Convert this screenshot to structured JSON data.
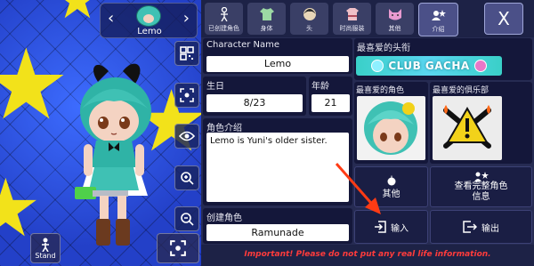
{
  "selector": {
    "name": "Lemo",
    "prev_glyph": "‹",
    "next_glyph": "›"
  },
  "stage": {
    "stand_label": "Stand"
  },
  "toolbar": {
    "icons": [
      "qr-code-icon",
      "scan-frame-icon",
      "eye-icon",
      "zoom-in-icon",
      "zoom-out-icon"
    ]
  },
  "tabs": [
    {
      "label": "已创建角色",
      "icon": "person-icon"
    },
    {
      "label": "身体",
      "icon": "shirt-icon"
    },
    {
      "label": "头",
      "icon": "head-icon"
    },
    {
      "label": "时尚服装",
      "icon": "outfit-icon"
    },
    {
      "label": "其他",
      "icon": "cat-icon"
    },
    {
      "label": "介绍",
      "icon": "profile-icon"
    }
  ],
  "close_label": "X",
  "profile": {
    "name_label": "Character Name",
    "name_value": "Lemo",
    "birthday_label": "生日",
    "birthday_value": "8/23",
    "age_label": "年龄",
    "age_value": "21",
    "intro_label": "角色介绍",
    "intro_value": "Lemo is Yuni's older sister.",
    "creator_label": "创建角色",
    "creator_value": "Ramunade"
  },
  "favorites": {
    "title_label": "最喜爱的头衔",
    "title_value": "CLUB GACHA",
    "character_label": "最喜爱的角色",
    "club_label": "最喜爱的俱乐部"
  },
  "buttons": {
    "other": "其他",
    "view_full": "查看完整角色信息",
    "import": "输入",
    "export": "输出"
  },
  "footer": "Important! Please do not put any real life information.",
  "colors": {
    "accent_teal": "#3fc1b4",
    "warning_red": "#ff3b3b",
    "star_yellow": "#f2e21a"
  }
}
